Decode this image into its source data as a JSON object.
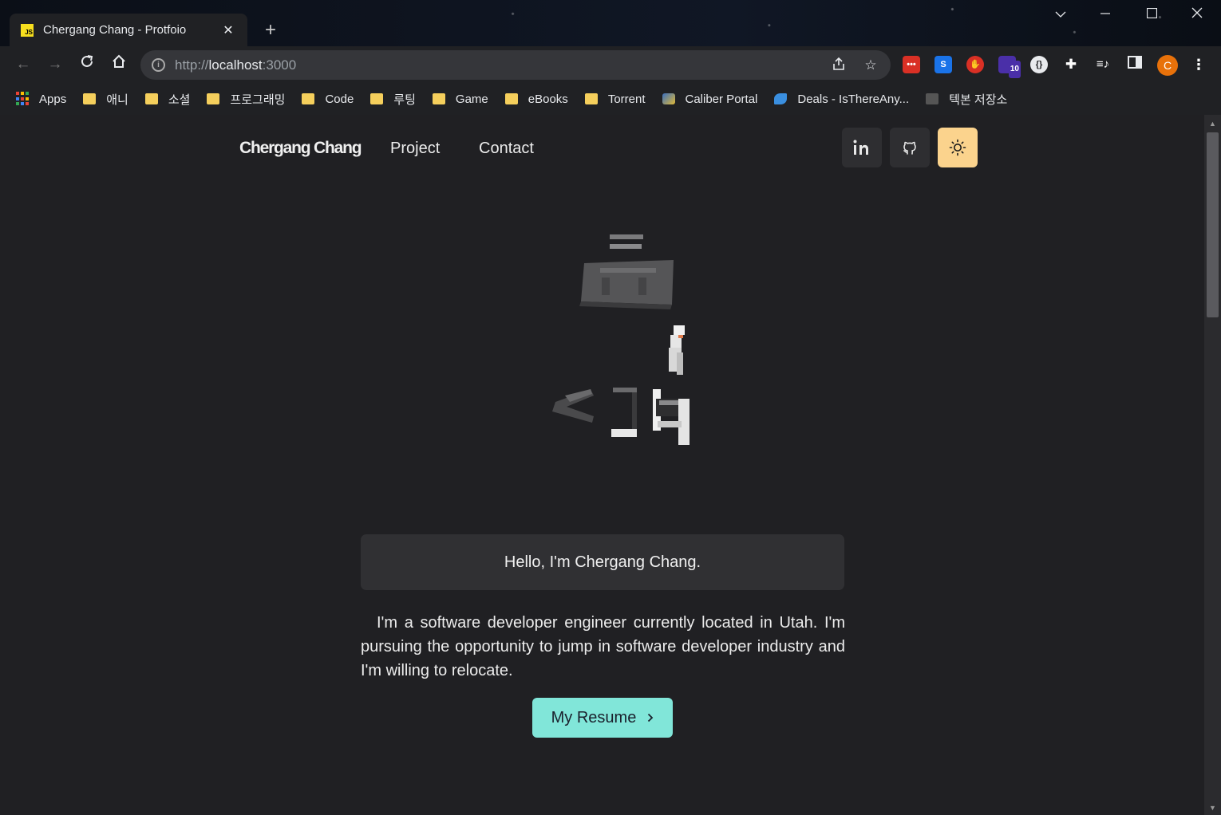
{
  "browser": {
    "tab_title": "Chergang Chang - Protfoio",
    "tab_favicon_text": "JS",
    "url_scheme": "http://",
    "url_host": "localhost",
    "url_port": ":3000",
    "profile_initial": "C",
    "extension_badge": "10"
  },
  "bookmarks": [
    {
      "label": "Apps",
      "icon": "apps-grid-icon"
    },
    {
      "label": "애니",
      "icon": "folder-icon"
    },
    {
      "label": "소셜",
      "icon": "folder-icon"
    },
    {
      "label": "프로그래밍",
      "icon": "folder-icon"
    },
    {
      "label": "Code",
      "icon": "folder-icon"
    },
    {
      "label": "루팅",
      "icon": "folder-icon"
    },
    {
      "label": "Game",
      "icon": "folder-icon"
    },
    {
      "label": "eBooks",
      "icon": "folder-icon"
    },
    {
      "label": "Torrent",
      "icon": "folder-icon"
    },
    {
      "label": "Caliber Portal",
      "icon": "caliber-icon"
    },
    {
      "label": "Deals - IsThereAny...",
      "icon": "deals-icon"
    },
    {
      "label": "텍본 저장소",
      "icon": "site-icon"
    }
  ],
  "site": {
    "brand": "Chergang Chang",
    "nav": [
      "Project",
      "Contact"
    ],
    "greeting": "Hello, I'm Chergang Chang.",
    "intro": "I'm a software developer engineer currently located in Utah. I'm pursuing the opportunity to jump in software developer industry and I'm willing to relocate.",
    "resume_label": "My Resume"
  },
  "colors": {
    "page_bg": "#202023",
    "theme_button": "#fbd38d",
    "resume_button": "#81e6d9"
  }
}
